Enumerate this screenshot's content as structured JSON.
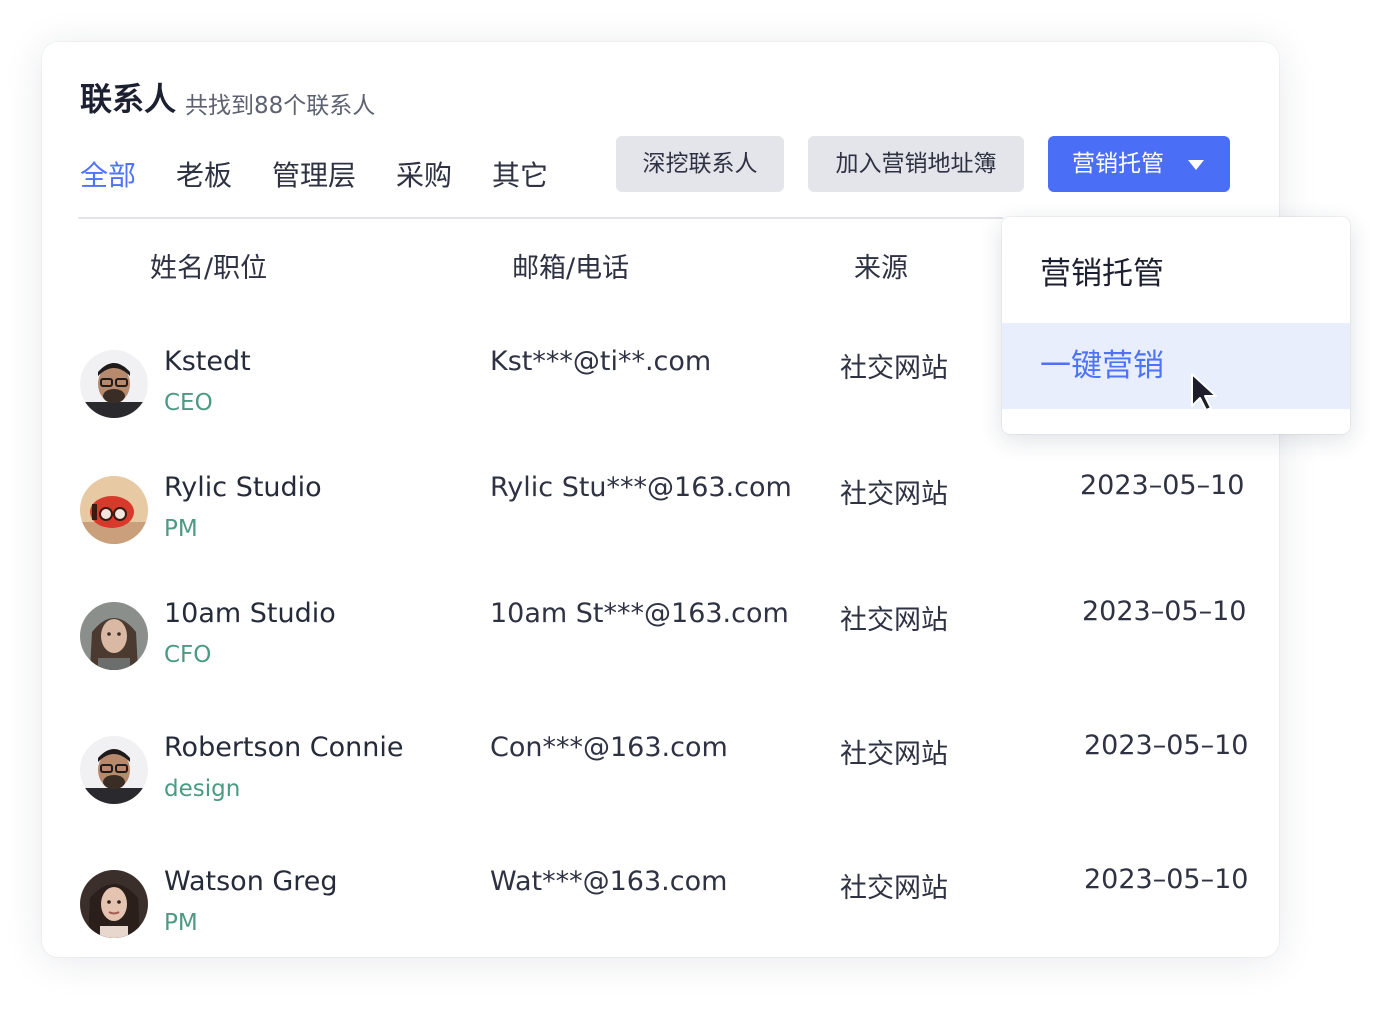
{
  "header": {
    "title": "联系人",
    "subtitle": "共找到88个联系人"
  },
  "tabs": [
    {
      "label": "全部",
      "active": true
    },
    {
      "label": "老板"
    },
    {
      "label": "管理层"
    },
    {
      "label": "采购"
    },
    {
      "label": "其它"
    }
  ],
  "toolbar": {
    "deep_mine_label": "深挖联系人",
    "add_address_book_label": "加入营销地址簿",
    "marketing_hosting_label": "营销托管"
  },
  "table": {
    "columns": [
      "姓名/职位",
      "邮箱/电话",
      "来源"
    ],
    "rows": [
      {
        "name": "Kstedt",
        "role": "CEO",
        "email": "Kst***@ti**.com",
        "source": "社交网站",
        "date": ""
      },
      {
        "name": "Rylic Studio",
        "role": "PM",
        "email": "Rylic Stu***@163.com",
        "source": "社交网站",
        "date": "2023–05–10"
      },
      {
        "name": "10am Studio",
        "role": "CFO",
        "email": "10am St***@163.com",
        "source": "社交网站",
        "date": "2023–05–10"
      },
      {
        "name": "Robertson Connie",
        "role": "design",
        "email": "Con***@163.com",
        "source": "社交网站",
        "date": "2023–05–10"
      },
      {
        "name": "Watson Greg",
        "role": "PM",
        "email": "Wat***@163.com",
        "source": "社交网站",
        "date": "2023–05–10"
      }
    ]
  },
  "dropdown": {
    "items": [
      {
        "label": "营销托管"
      },
      {
        "label": "一键营销",
        "highlighted": true
      }
    ]
  },
  "colors": {
    "accent": "#4a6ef6",
    "role_text": "#4b9a84",
    "button_gray": "#e3e5ea",
    "highlight_bg": "#e9eefd"
  },
  "icons": {
    "dropdown_caret": "caret-down-icon",
    "pointer": "mouse-pointer-icon"
  }
}
